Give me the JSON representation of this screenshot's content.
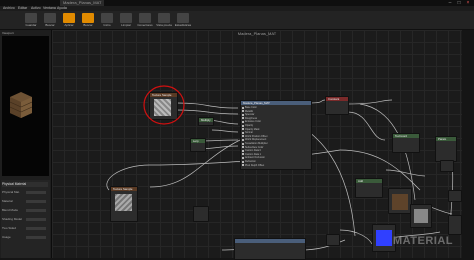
{
  "window": {
    "tabs": [
      "Madera_Planas_MAT"
    ],
    "accent": "#e08a00"
  },
  "menu": [
    "Archivo",
    "Editar",
    "Activo",
    "Ventana",
    "Ayuda"
  ],
  "toolbar": [
    {
      "label": "Guardar",
      "icon": "save-icon",
      "color": "#444444"
    },
    {
      "label": "Buscar",
      "icon": "search-icon",
      "color": "#444444"
    },
    {
      "label": "Aplicar",
      "icon": "apply-icon",
      "color": "#e08a00"
    },
    {
      "label": "Buscar",
      "icon": "find-icon",
      "color": "#e08a00"
    },
    {
      "label": "Inicio",
      "icon": "home-icon",
      "color": "#444444"
    },
    {
      "label": "Limpiar",
      "icon": "clean-icon",
      "color": "#444444"
    },
    {
      "label": "Conectores",
      "icon": "connectors-icon",
      "color": "#444444"
    },
    {
      "label": "Vista previa",
      "icon": "preview-icon",
      "color": "#444444"
    },
    {
      "label": "Estadísticas",
      "icon": "stats-icon",
      "color": "#444444"
    }
  ],
  "viewport": {
    "label": "Viewport"
  },
  "details": {
    "section": "Physical Material",
    "rows": [
      "Physical Mat.",
      "Material",
      "Blend Mode",
      "Shading Model",
      "Two Sided",
      "Usage"
    ]
  },
  "graph": {
    "title": "Madera_Planas_MAT",
    "main_node": {
      "title": "Madera_Planas_MAT",
      "pins": [
        "Base Color",
        "Metallic",
        "Specular",
        "Roughness",
        "Emissive Color",
        "Opacity",
        "Opacity Mask",
        "Normal",
        "World Position Offset",
        "World Displacement",
        "Tessellation Multiplier",
        "Subsurface Color",
        "Custom Data 0",
        "Custom Data 1",
        "Ambient Occlusion",
        "Refraction",
        "Pixel Depth Offset"
      ]
    },
    "texture_nodes": [
      "Texture Sample",
      "Texture Sample"
    ],
    "small_nodes": [
      "Multiply",
      "Lerp",
      "Constant",
      "TexCoord",
      "Add",
      "Param"
    ],
    "watermark": "MATERIAL"
  }
}
